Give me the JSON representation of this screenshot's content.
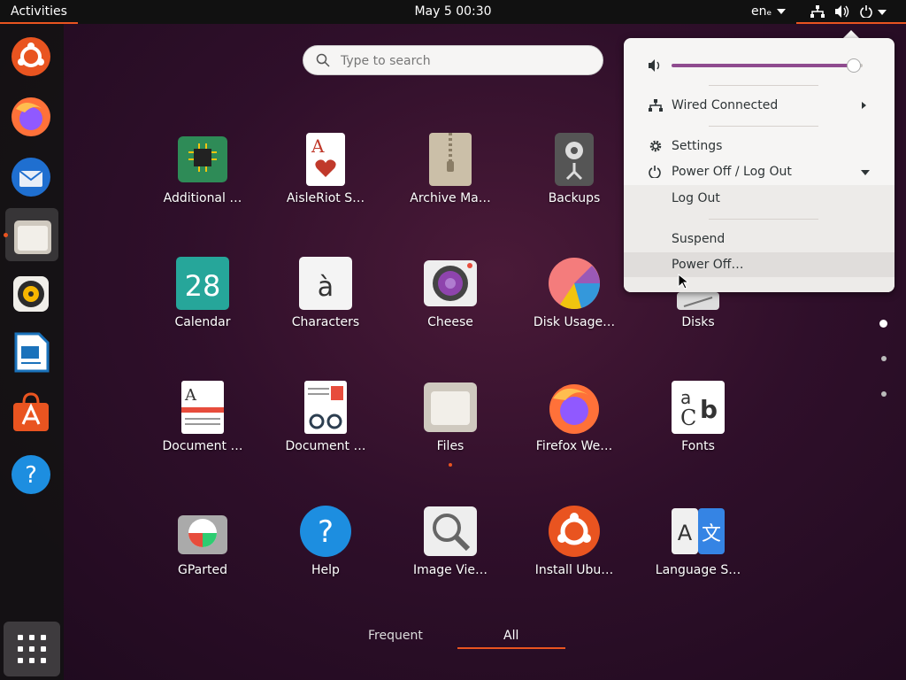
{
  "topbar": {
    "activities": "Activities",
    "clock": "May 5  00:30",
    "language": "enₑ"
  },
  "dock": {
    "items": [
      {
        "name": "Ubuntu Software"
      },
      {
        "name": "Firefox"
      },
      {
        "name": "Thunderbird"
      },
      {
        "name": "Files"
      },
      {
        "name": "Rhythmbox"
      },
      {
        "name": "LibreOffice Writer"
      },
      {
        "name": "Ubuntu Software Center"
      },
      {
        "name": "Help"
      }
    ]
  },
  "search": {
    "placeholder": "Type to search"
  },
  "apps": [
    {
      "label": "Additional …"
    },
    {
      "label": "AisleRiot S…"
    },
    {
      "label": "Archive Ma…"
    },
    {
      "label": "Backups"
    },
    {
      "label": "Calendar",
      "icon_text": "28"
    },
    {
      "label": "Characters",
      "icon_text": "à"
    },
    {
      "label": "Cheese"
    },
    {
      "label": "Disk Usage…"
    },
    {
      "label": "Disks"
    },
    {
      "label": "Document …"
    },
    {
      "label": "Document …"
    },
    {
      "label": "Files"
    },
    {
      "label": "Firefox We…"
    },
    {
      "label": "Fonts"
    },
    {
      "label": "GParted"
    },
    {
      "label": "Help"
    },
    {
      "label": "Image Vie…"
    },
    {
      "label": "Install Ubu…"
    },
    {
      "label": "Language S…"
    }
  ],
  "tabs": {
    "frequent": "Frequent",
    "all": "All"
  },
  "system_menu": {
    "volume_level": 0.95,
    "wired": "Wired Connected",
    "settings": "Settings",
    "power_section": "Power Off / Log Out",
    "log_out": "Log Out",
    "suspend": "Suspend",
    "power_off": "Power Off…"
  },
  "colors": {
    "accent": "#e95420",
    "slider": "#8f4b8f"
  }
}
